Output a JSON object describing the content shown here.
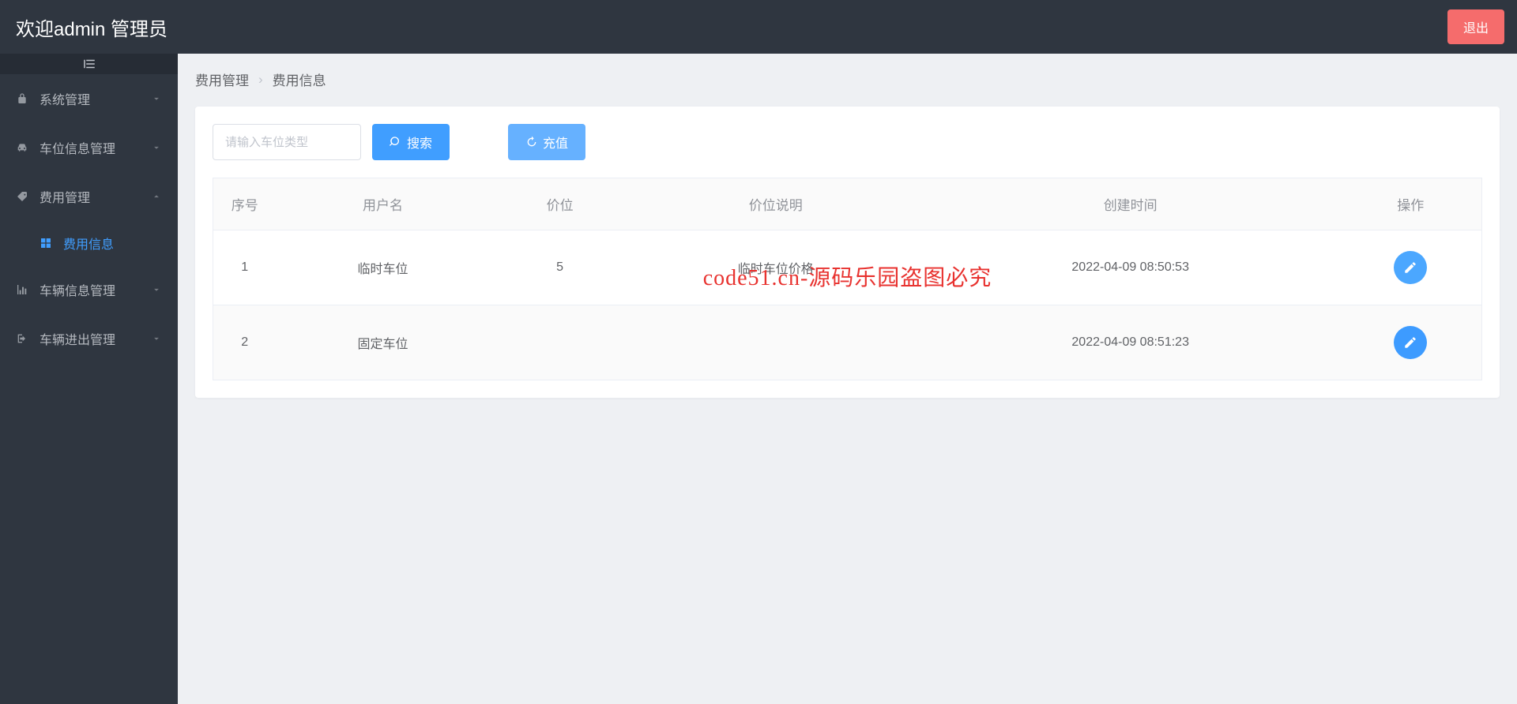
{
  "header": {
    "welcome": "欢迎admin 管理员",
    "logout": "退出"
  },
  "sidebar": {
    "items": [
      {
        "label": "系统管理",
        "icon": "lock-icon",
        "expanded": false
      },
      {
        "label": "车位信息管理",
        "icon": "car-icon",
        "expanded": false
      },
      {
        "label": "费用管理",
        "icon": "tag-icon",
        "expanded": true,
        "children": [
          {
            "label": "费用信息",
            "icon": "grid-icon",
            "active": true
          }
        ]
      },
      {
        "label": "车辆信息管理",
        "icon": "chart-icon",
        "expanded": false
      },
      {
        "label": "车辆进出管理",
        "icon": "exit-icon",
        "expanded": false
      }
    ]
  },
  "breadcrumb": {
    "a": "费用管理",
    "b": "费用信息"
  },
  "search": {
    "placeholder": "请输入车位类型",
    "search_btn": "搜索",
    "recharge_btn": "充值"
  },
  "table": {
    "headers": {
      "no": "序号",
      "username": "用户名",
      "price": "价位",
      "desc": "价位说明",
      "created": "创建时间",
      "action": "操作"
    },
    "rows": [
      {
        "no": "1",
        "username": "临时车位",
        "price": "5",
        "desc": "临时车位价格",
        "created": "2022-04-09 08:50:53"
      },
      {
        "no": "2",
        "username": "固定车位",
        "price": "",
        "desc": "",
        "created": "2022-04-09 08:51:23"
      }
    ]
  },
  "watermark": "code51.cn-源码乐园盗图必究"
}
